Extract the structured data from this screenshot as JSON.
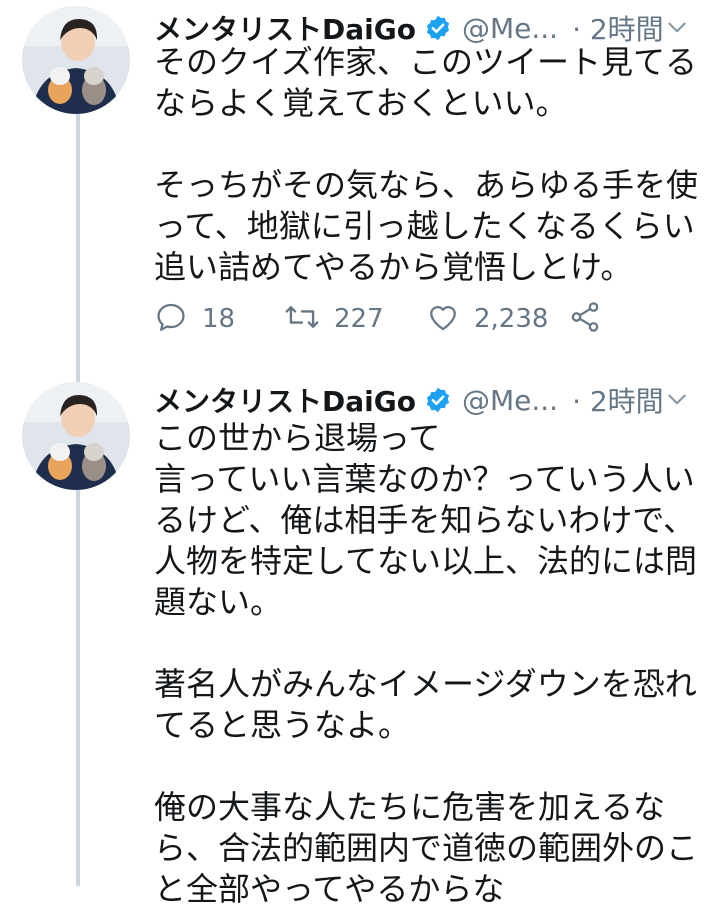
{
  "tweets": [
    {
      "name": "メンタリストDaiGo",
      "handle": "@Me...",
      "time": "· 2時間",
      "text": "そのクイズ作家、このツイート見てるならよく覚えておくといい。\n\nそっちがその気なら、あらゆる手を使って、地獄に引っ越したくなるくらい追い詰めてやるから覚悟しとけ。",
      "replies": "18",
      "retweets": "227",
      "likes": "2,238"
    },
    {
      "name": "メンタリストDaiGo",
      "handle": "@Me...",
      "time": "· 2時間",
      "text": "この世から退場って\n言っていい言葉なのか？っていう人いるけど、俺は相手を知らないわけで、人物を特定してない以上、法的には問題ない。\n\n著名人がみんなイメージダウンを恐れてると思うなよ。\n\n俺の大事な人たちに危害を加えるなら、合法的範囲内で道徳の範囲外のこと全部やってやるからな"
    }
  ],
  "icons": {
    "verified": "verified-badge-icon",
    "chevron": "chevron-down-icon",
    "reply": "reply-icon",
    "retweet": "retweet-icon",
    "like": "heart-icon",
    "share": "share-icon"
  },
  "colors": {
    "verified": "#1da1f2",
    "secondary_text": "#657786",
    "thread_line": "#ccd6dd"
  }
}
